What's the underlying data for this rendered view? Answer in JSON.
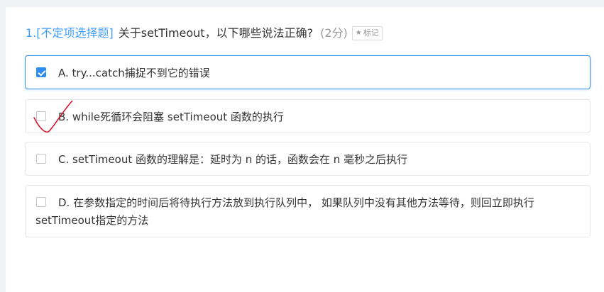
{
  "question": {
    "number": "1.",
    "type": "[不定项选择题]",
    "text": "关于setTimeout，以下哪些说法正确?",
    "score": "(2分)",
    "mark_icon": "star-icon",
    "mark_label": "标记"
  },
  "options": [
    {
      "label": "A. try...catch捕捉不到它的错误",
      "checked": true
    },
    {
      "label": "B. while死循环会阻塞 setTimeout 函数的执行",
      "checked": false
    },
    {
      "label": "C. setTimeout 函数的理解是：延时为 n 的话，函数会在 n 毫秒之后执行",
      "checked": false
    },
    {
      "label": "D. 在参数指定的时间后将待执行方法放到执行队列中， 如果队列中没有其他方法等待，则回立即执行setTimeout指定的方法",
      "checked": false
    }
  ],
  "colors": {
    "accent": "#409eff",
    "checked": "#2d8cf0",
    "annotation": "#d9001b"
  }
}
